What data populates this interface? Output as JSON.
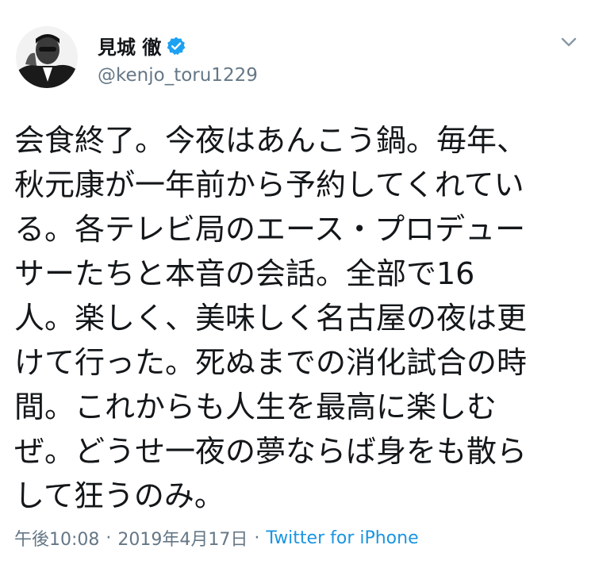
{
  "author": {
    "display_name": "見城 徹",
    "handle": "@kenjo_toru1229",
    "verified": true,
    "avatar_icon": "avatar-photo"
  },
  "menu": {
    "icon": "chevron-down-icon"
  },
  "tweet": {
    "lines": [
      "会食終了。今夜はあんこう鍋。毎年、",
      "秋元康が一年前から予約してくれてい",
      "る。各テレビ局のエース・プロデュー",
      "サーたちと本音の会話。全部で16",
      "人。楽しく、美味しく名古屋の夜は更",
      "けて行った。死ぬまでの消化試合の時",
      "間。これからも人生を最高に楽しむ",
      "ぜ。どうせ一夜の夢ならば身をも散ら",
      "して狂うのみ。"
    ]
  },
  "meta": {
    "time": "午後10:08",
    "separator": "·",
    "date": "2019年4月17日",
    "source": "Twitter for iPhone"
  },
  "colors": {
    "verified_blue": "#1da1f2",
    "link_blue": "#1b95e0",
    "secondary_text": "#657786",
    "primary_text": "#14171a"
  }
}
